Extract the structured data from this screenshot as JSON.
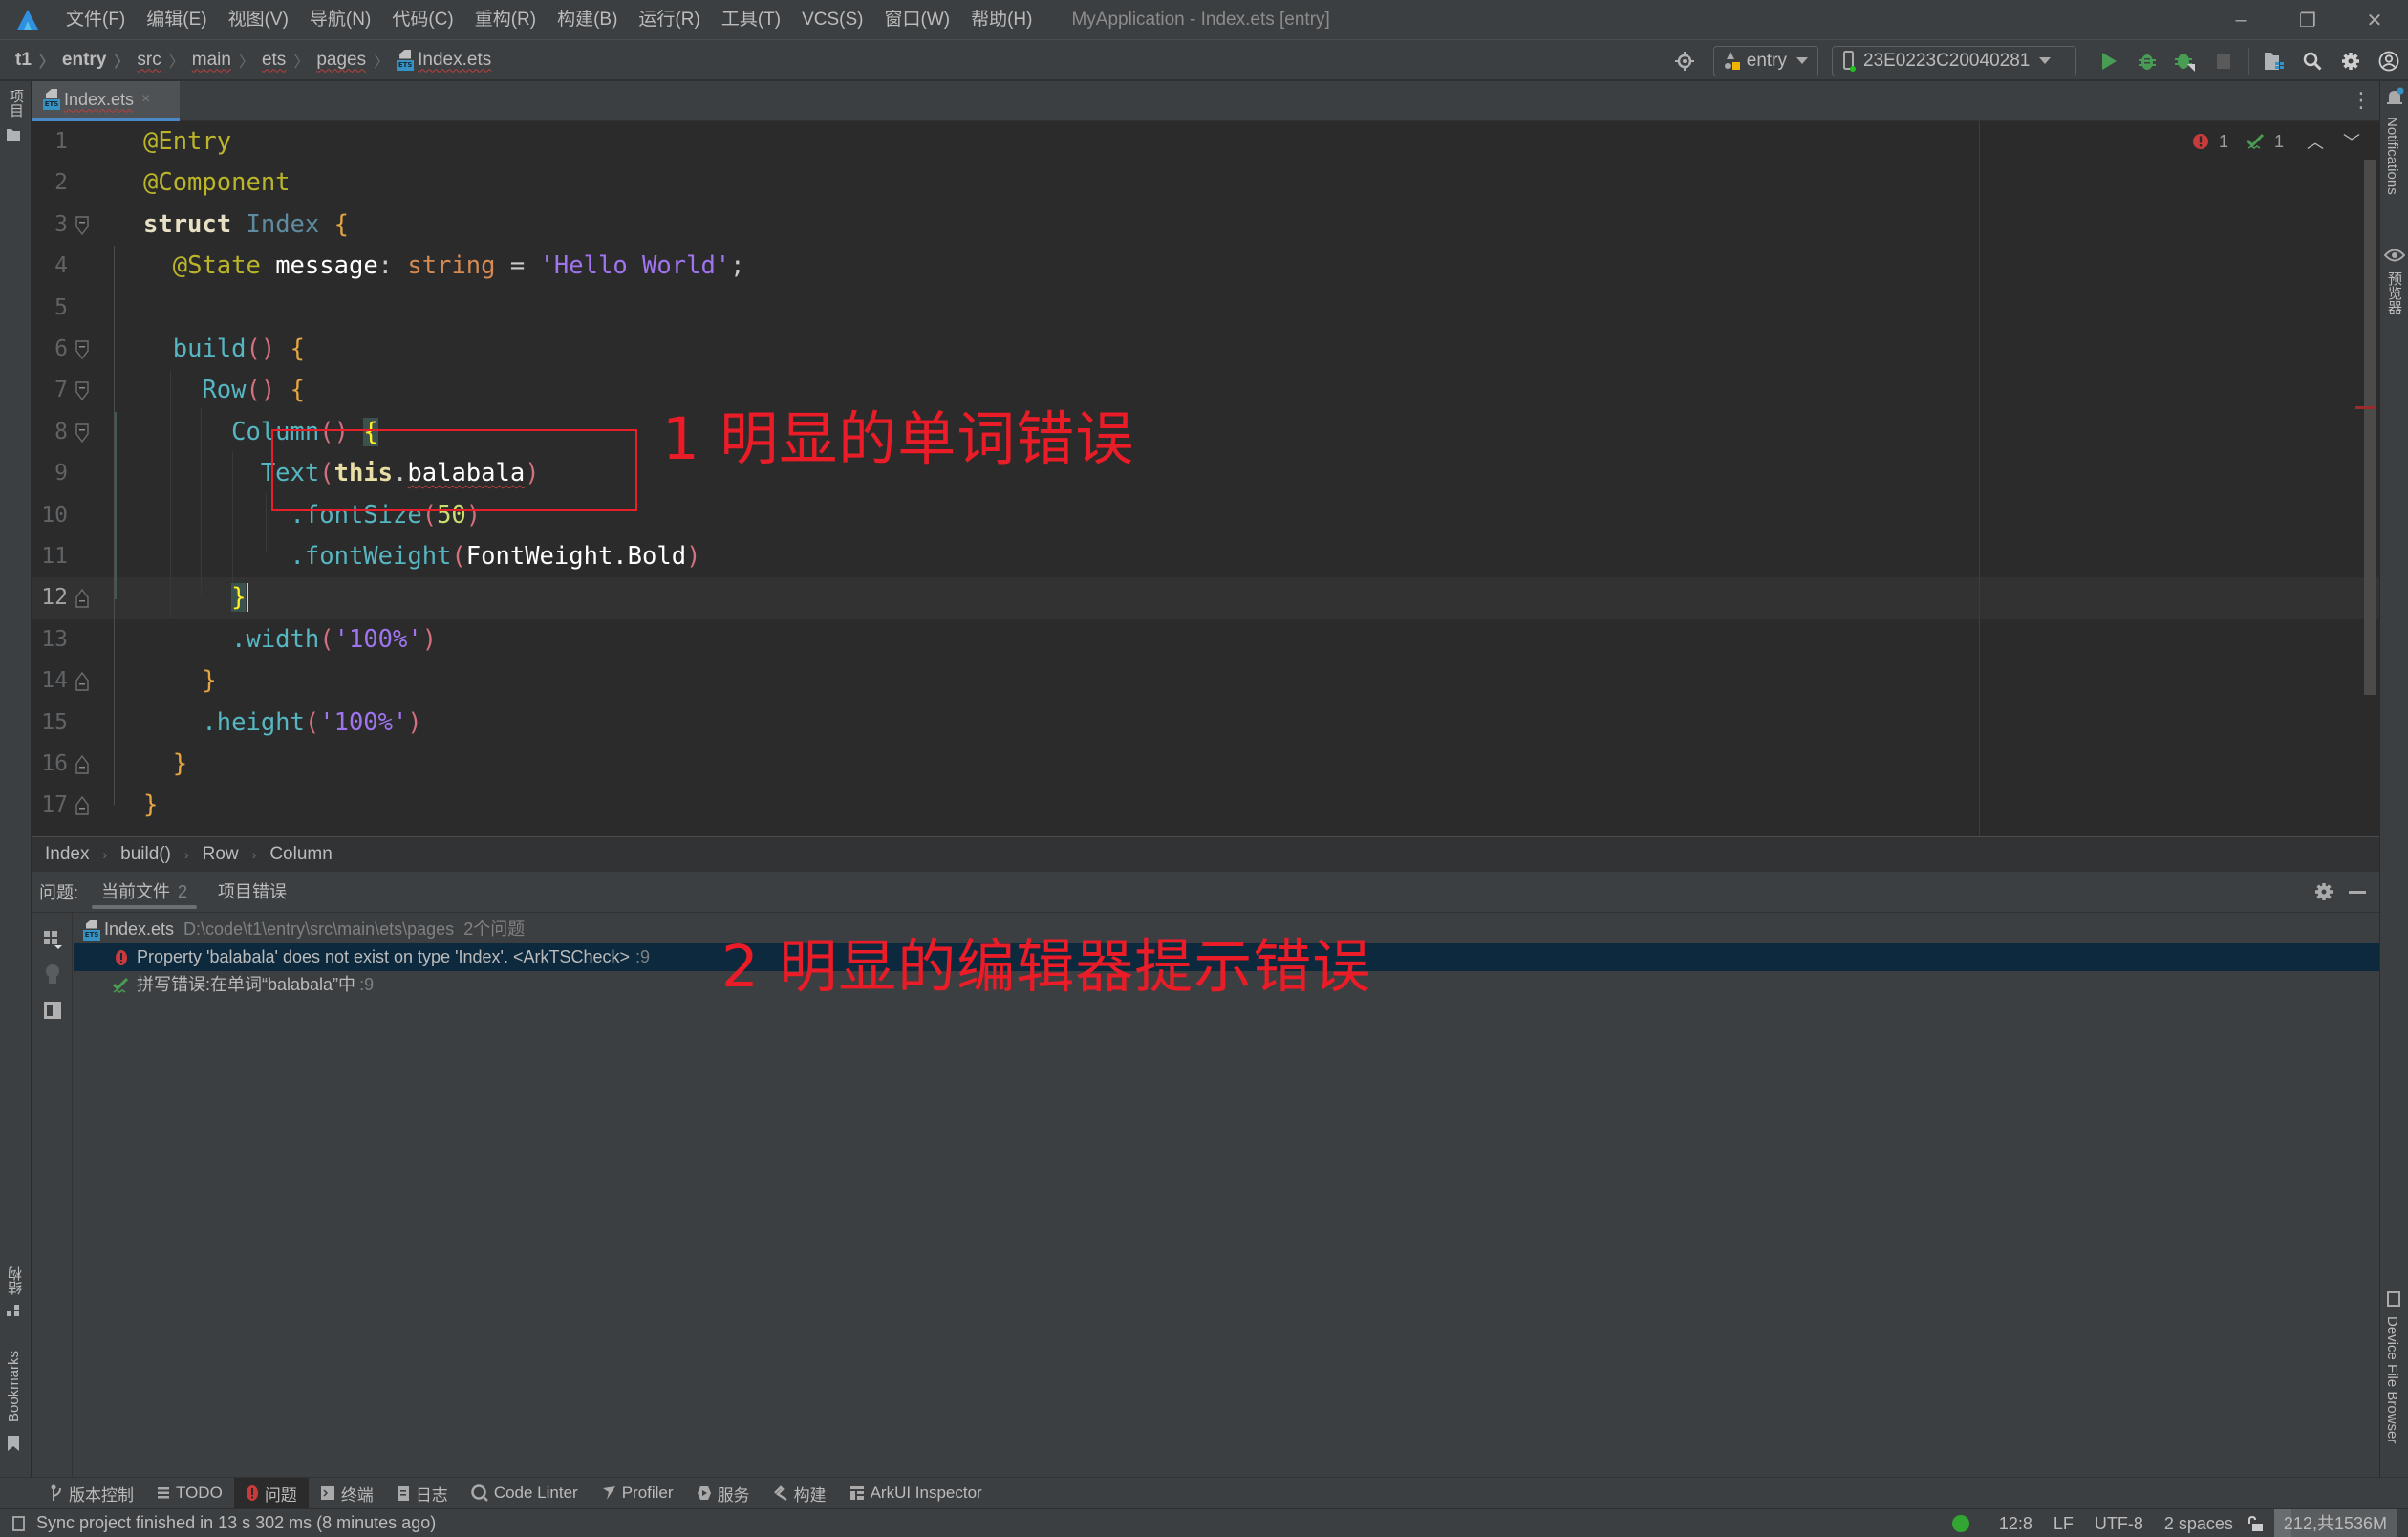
{
  "titlebar": {
    "menu": [
      "文件(F)",
      "编辑(E)",
      "视图(V)",
      "导航(N)",
      "代码(C)",
      "重构(R)",
      "构建(B)",
      "运行(R)",
      "工具(T)",
      "VCS(S)",
      "窗口(W)",
      "帮助(H)"
    ],
    "title": "MyApplication - Index.ets [entry]",
    "controls": {
      "minimize": "–",
      "restore": "❐",
      "close": "✕"
    }
  },
  "navbar": {
    "breadcrumb": [
      "t1",
      "entry",
      "src",
      "main",
      "ets",
      "pages",
      "Index.ets"
    ],
    "module_selector": "entry",
    "device_selector": "23E0223C20040281",
    "icons": [
      "locate-icon",
      "run-icon",
      "debug-icon",
      "attach-debugger-icon",
      "stop-icon",
      "project-structure-icon",
      "search-icon",
      "settings-icon",
      "account-icon"
    ]
  },
  "left_strip": {
    "top_label": "项目",
    "structure_label": "结构",
    "bookmarks_label": "Bookmarks"
  },
  "right_strip": {
    "notifications_label": "Notifications",
    "previewer_label": "预览器",
    "device_file_browser_label": "Device File Browser"
  },
  "editor": {
    "tab": {
      "label": "Index.ets",
      "close": "×"
    },
    "inspection": {
      "errors": "1",
      "warnings": "1"
    },
    "current_line": 12,
    "lines": [
      {
        "n": "1"
      },
      {
        "n": "2"
      },
      {
        "n": "3"
      },
      {
        "n": "4"
      },
      {
        "n": "5"
      },
      {
        "n": "6"
      },
      {
        "n": "7"
      },
      {
        "n": "8"
      },
      {
        "n": "9"
      },
      {
        "n": "10"
      },
      {
        "n": "11"
      },
      {
        "n": "12"
      },
      {
        "n": "13"
      },
      {
        "n": "14"
      },
      {
        "n": "15"
      },
      {
        "n": "16"
      },
      {
        "n": "17"
      }
    ],
    "tokens": {
      "l1": [
        "@Entry"
      ],
      "l2": [
        "@Component"
      ],
      "l3": [
        "struct",
        " ",
        "Index",
        " ",
        "{"
      ],
      "l4": [
        "  ",
        "@State",
        " ",
        "message",
        ": ",
        "string",
        " = ",
        "'Hello World'",
        ";"
      ],
      "l6": [
        "  ",
        "build",
        "()",
        " ",
        "{"
      ],
      "l7": [
        "    ",
        "Row",
        "()",
        " ",
        "{"
      ],
      "l8": [
        "      ",
        "Column",
        "()",
        " ",
        "{"
      ],
      "l9": [
        "        ",
        "Text",
        "(",
        "this",
        ".",
        "balabala",
        ")"
      ],
      "l10": [
        "          ",
        ".fontSize",
        "(",
        "50",
        ")"
      ],
      "l11": [
        "          ",
        ".fontWeight",
        "(",
        "FontWeight.Bold",
        ")"
      ],
      "l12": [
        "      ",
        "}"
      ],
      "l13": [
        "      ",
        ".width",
        "(",
        "'100%'",
        ")"
      ],
      "l14": [
        "    ",
        "}"
      ],
      "l15": [
        "    ",
        ".height",
        "(",
        "'100%'",
        ")"
      ],
      "l16": [
        "  ",
        "}"
      ],
      "l17": [
        "}"
      ]
    }
  },
  "annotations": {
    "label_1": "1 明显的单词错误",
    "label_2": "2 明显的编辑器提示错误",
    "color": "#e8202a"
  },
  "structure_breadcrumb": [
    "Index",
    "build()",
    "Row",
    "Column"
  ],
  "problems": {
    "label": "问题:",
    "tabs": [
      {
        "label": "当前文件",
        "count": "2"
      },
      {
        "label": "项目错误",
        "count": ""
      }
    ],
    "file": {
      "name": "Index.ets",
      "path": "D:\\code\\t1\\entry\\src\\main\\ets\\pages",
      "summary": "2个问题"
    },
    "items": [
      {
        "severity": "error",
        "text": "Property 'balabala' does not exist on type 'Index'. <ArkTSCheck>",
        "line": ":9"
      },
      {
        "severity": "typo",
        "text": "拼写错误:在单词“balabala”中",
        "line": ":9"
      }
    ]
  },
  "tool_windows": [
    {
      "label": "版本控制",
      "icon": "vcs-icon"
    },
    {
      "label": "TODO",
      "icon": "todo-icon"
    },
    {
      "label": "问题",
      "icon": "problems-icon",
      "active": true
    },
    {
      "label": "终端",
      "icon": "terminal-icon"
    },
    {
      "label": "日志",
      "icon": "log-icon"
    },
    {
      "label": "Code Linter",
      "icon": "code-linter-icon"
    },
    {
      "label": "Profiler",
      "icon": "profiler-icon"
    },
    {
      "label": "服务",
      "icon": "services-icon"
    },
    {
      "label": "构建",
      "icon": "build-icon"
    },
    {
      "label": "ArkUI Inspector",
      "icon": "arkui-inspector-icon"
    }
  ],
  "statusbar": {
    "message": "Sync project finished in 13 s 302 ms (8 minutes ago)",
    "caret": "12:8",
    "line_sep": "LF",
    "encoding": "UTF-8",
    "indent": "2 spaces",
    "memory": "212,共1536M"
  },
  "colors": {
    "accent": "#4a88c7",
    "error": "#c93b3b",
    "ok": "#499c54",
    "selection": "#0d293e"
  }
}
